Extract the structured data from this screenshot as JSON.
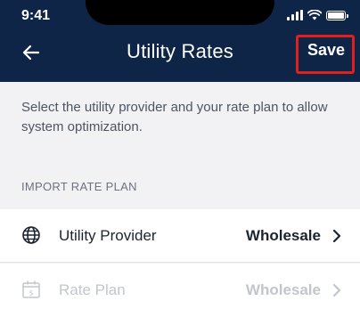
{
  "status_bar": {
    "time": "9:41"
  },
  "header": {
    "title": "Utility Rates",
    "save_label": "Save",
    "back_icon": "arrow-left-icon"
  },
  "description": "Select the utility provider and your rate plan to allow system optimization.",
  "section": {
    "label": "IMPORT RATE PLAN"
  },
  "rows": [
    {
      "label": "Utility Provider",
      "value": "Wholesale",
      "icon": "globe-icon",
      "enabled": true
    },
    {
      "label": "Rate Plan",
      "value": "Wholesale",
      "icon": "calendar-dollar-icon",
      "enabled": false
    }
  ],
  "colors": {
    "header_bg": "#0f2548",
    "highlight": "#e0201f",
    "page_bg": "#f2f2f4"
  }
}
